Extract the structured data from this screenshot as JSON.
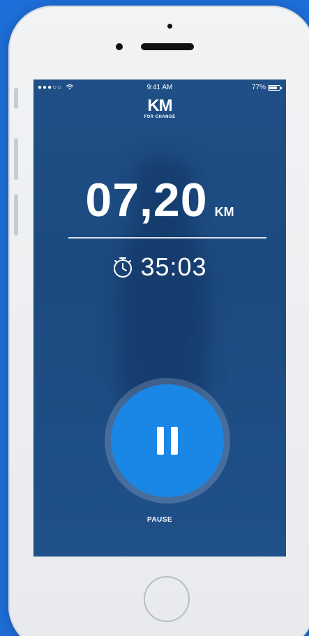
{
  "status_bar": {
    "signal": "●●●○○",
    "time": "9:41 AM",
    "battery": "77%"
  },
  "logo": {
    "mark": "KM",
    "subtitle": "FOR CHANGE"
  },
  "distance": {
    "value": "07,20",
    "unit": "KM"
  },
  "timer": {
    "icon": "stopwatch-icon",
    "value": "35:03"
  },
  "controls": {
    "pause_icon": "pause-icon",
    "pause_label": "PAUSE"
  },
  "colors": {
    "background": "#1e6fd9",
    "screen": "#1f4f86",
    "pause_button": "#1a86e6"
  }
}
